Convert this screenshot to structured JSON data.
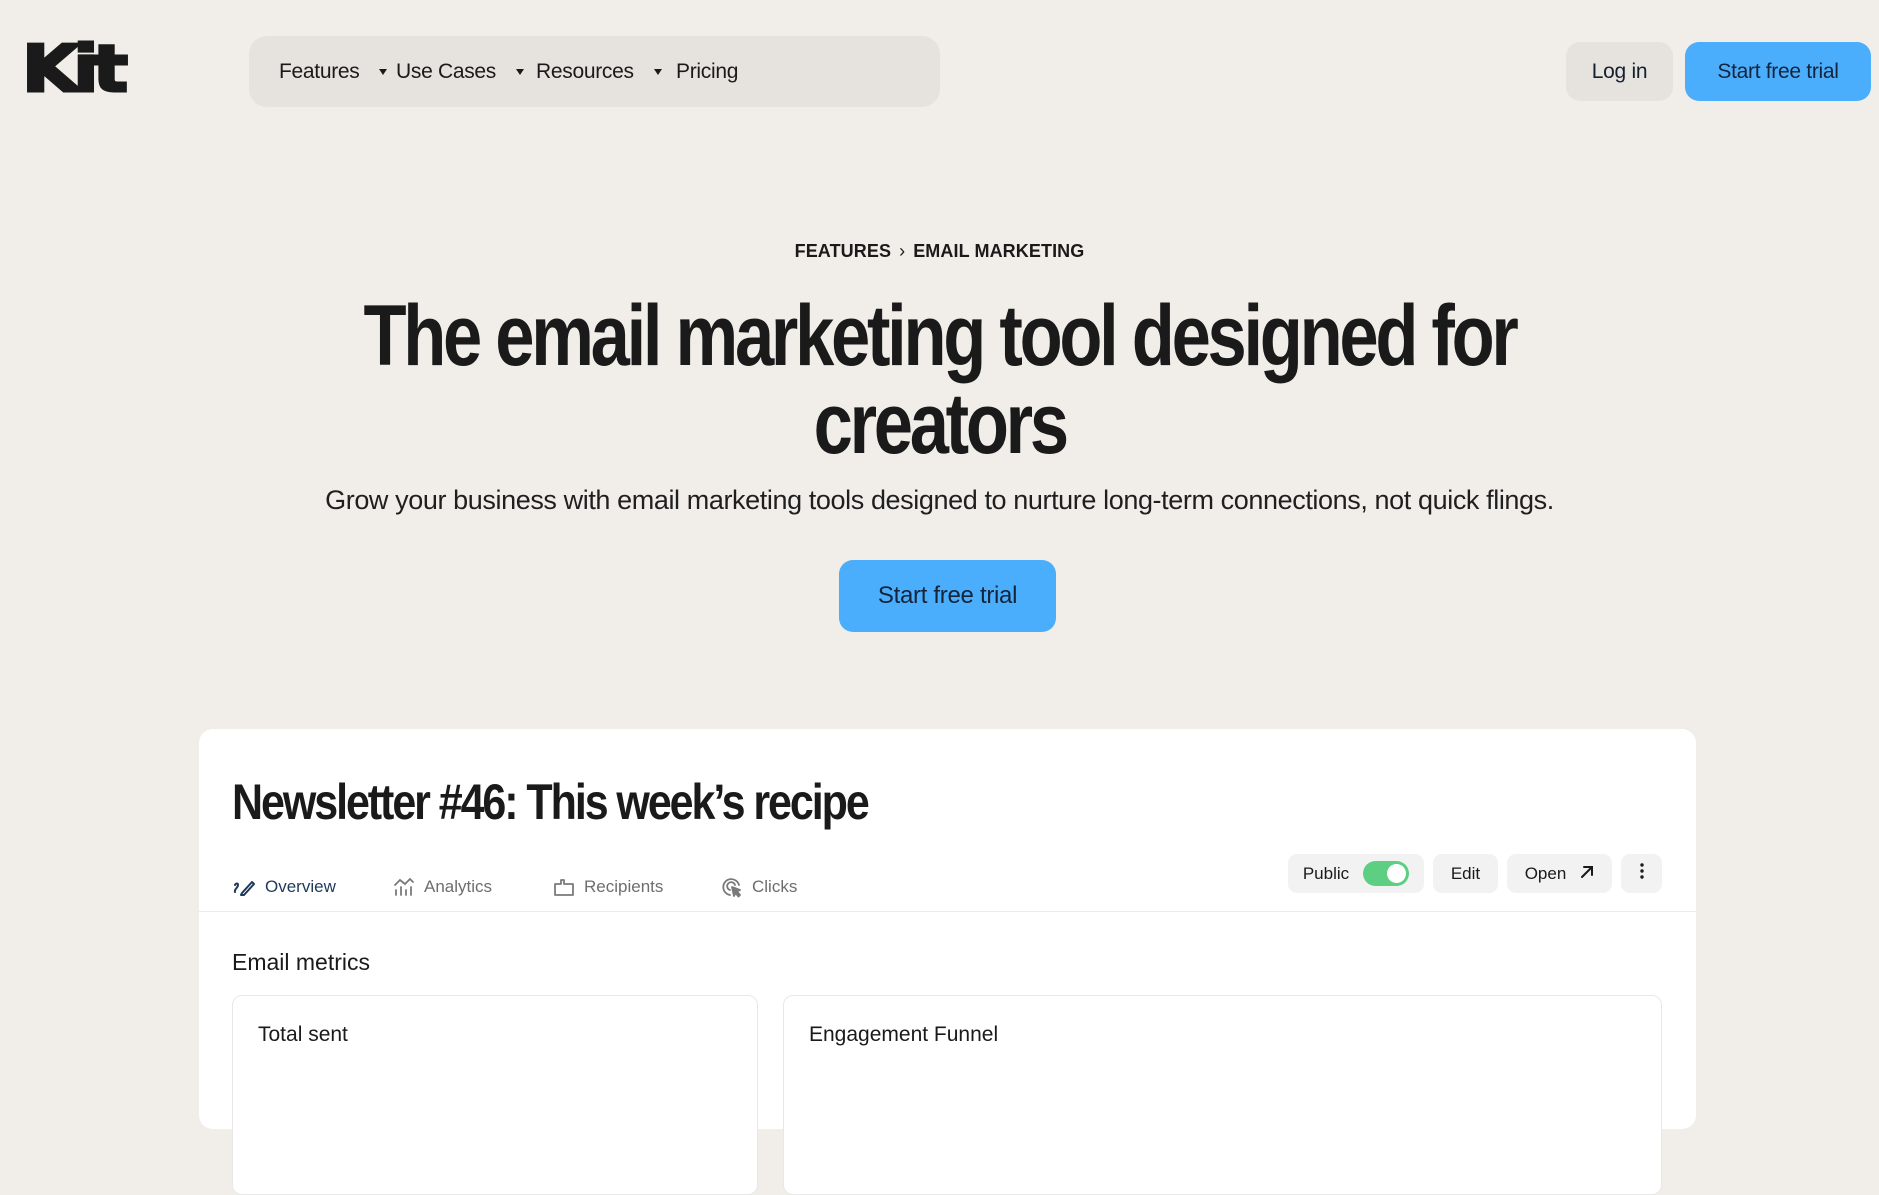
{
  "header": {
    "logo_text": "Kit",
    "nav": [
      {
        "label": "Features",
        "has_dropdown": true
      },
      {
        "label": "Use Cases",
        "has_dropdown": true
      },
      {
        "label": "Resources",
        "has_dropdown": true
      },
      {
        "label": "Pricing",
        "has_dropdown": false
      }
    ],
    "login_label": "Log in",
    "trial_label": "Start free trial"
  },
  "hero": {
    "breadcrumb": [
      "FEATURES",
      "EMAIL MARKETING"
    ],
    "breadcrumb_separator": "›",
    "headline_line1": "The email marketing tool designed for",
    "headline_line2": "creators",
    "subtitle": "Grow your business with email marketing tools designed to nurture long-term connections, not quick flings.",
    "cta_label": "Start free trial"
  },
  "preview_card": {
    "title": "Newsletter #46: This week’s recipe",
    "tabs": [
      {
        "label": "Overview",
        "icon": "pen-icon",
        "active": true
      },
      {
        "label": "Analytics",
        "icon": "chart-icon",
        "active": false
      },
      {
        "label": "Recipients",
        "icon": "folder-icon",
        "active": false
      },
      {
        "label": "Clicks",
        "icon": "cursor-click-icon",
        "active": false
      }
    ],
    "actions": {
      "public_label": "Public",
      "public_enabled": true,
      "edit_label": "Edit",
      "open_label": "Open",
      "open_icon": "arrow-up-right-icon",
      "more_icon": "vertical-ellipsis-icon"
    },
    "section_title": "Email metrics",
    "metrics": [
      {
        "label": "Total sent"
      },
      {
        "label": "Engagement Funnel"
      }
    ]
  },
  "colors": {
    "background": "#f1eee9",
    "accent_blue": "#4aaefd",
    "nav_pill": "#e6e3de",
    "toggle_on": "#5ccf82",
    "active_tab": "#1e3a5c"
  }
}
